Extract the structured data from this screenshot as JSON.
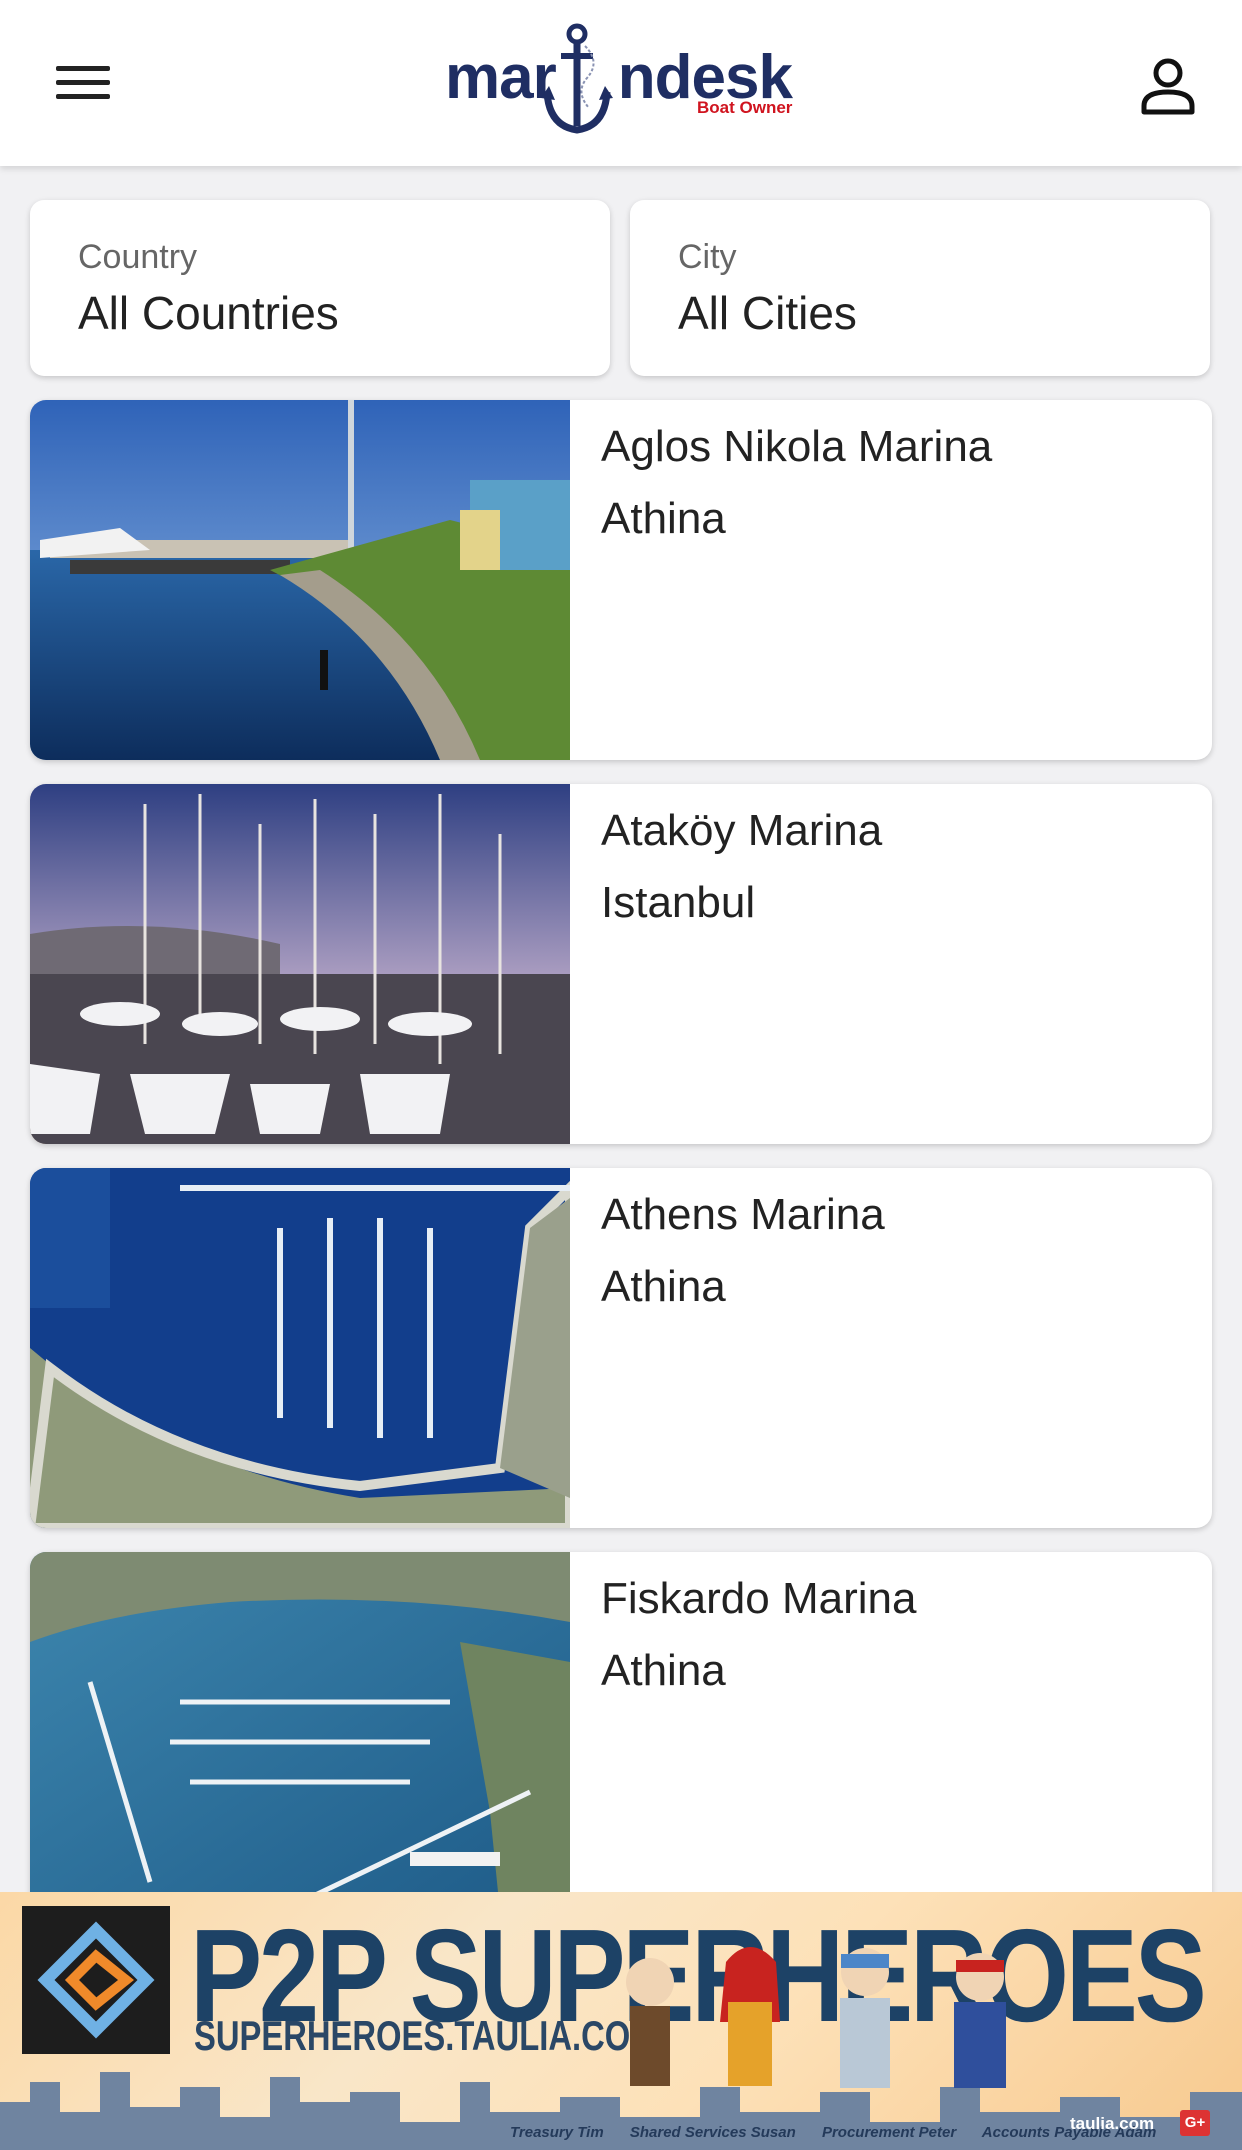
{
  "header": {
    "logo_text": "marindesk",
    "logo_subtitle": "Boat Owner",
    "menu_icon": "hamburger-menu-icon",
    "profile_icon": "user-profile-icon"
  },
  "filters": {
    "country": {
      "label": "Country",
      "value": "All Countries"
    },
    "city": {
      "label": "City",
      "value": "All Cities"
    }
  },
  "marinas": [
    {
      "name": "Aglos Nikola Marina",
      "city": "Athina"
    },
    {
      "name": "Ataköy Marina",
      "city": "Istanbul"
    },
    {
      "name": "Athens Marina",
      "city": "Athina"
    },
    {
      "name": "Fiskardo Marina",
      "city": "Athina"
    }
  ],
  "ad": {
    "headline": "P2P SUPERHEROES",
    "url": "SUPERHEROES.TAULIA.COM",
    "captions": [
      "Treasury Tim",
      "Shared Services Susan",
      "Procurement Peter",
      "Accounts Payable Adam"
    ],
    "domain": "taulia.com",
    "social": "G+"
  },
  "colors": {
    "brand_navy": "#1f2e63",
    "brand_red": "#d0141f",
    "page_background": "#f1f1f3"
  }
}
